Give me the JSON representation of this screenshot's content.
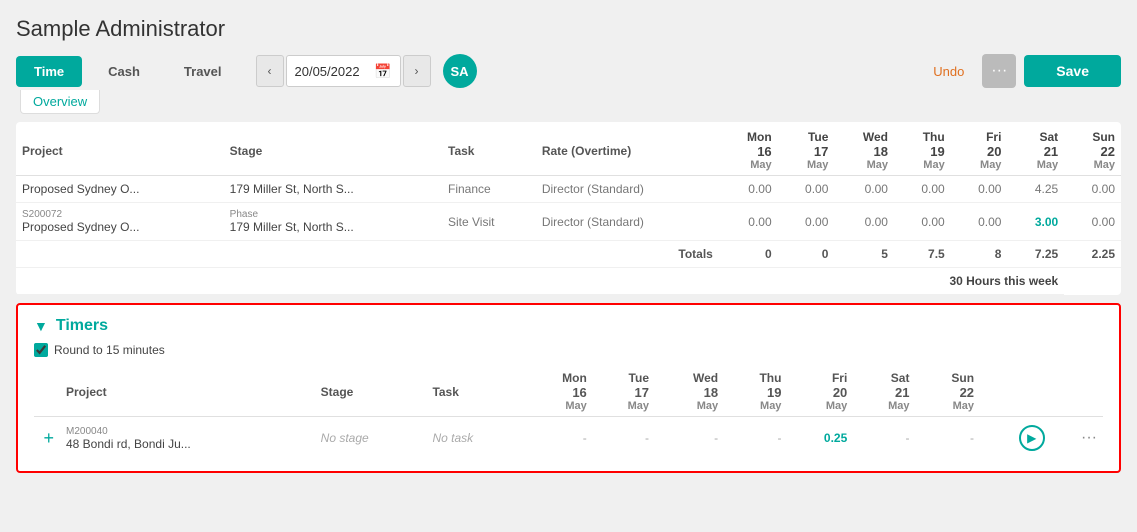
{
  "page": {
    "title": "Sample Administrator"
  },
  "toolbar": {
    "tabs": [
      {
        "id": "time",
        "label": "Time",
        "active": true
      },
      {
        "id": "cash",
        "label": "Cash",
        "active": false
      },
      {
        "id": "travel",
        "label": "Travel",
        "active": false
      }
    ],
    "sub_tabs": [
      {
        "id": "overview",
        "label": "Overview"
      }
    ],
    "date": "20/05/2022",
    "avatar": "SA",
    "undo_label": "Undo",
    "more_label": "...",
    "save_label": "Save"
  },
  "time_table": {
    "columns": {
      "project": "Project",
      "stage": "Stage",
      "task": "Task",
      "rate": "Rate (Overtime)",
      "days": [
        {
          "name": "Mon",
          "num": "16",
          "month": "May"
        },
        {
          "name": "Tue",
          "num": "17",
          "month": "May"
        },
        {
          "name": "Wed",
          "num": "18",
          "month": "May"
        },
        {
          "name": "Thu",
          "num": "19",
          "month": "May"
        },
        {
          "name": "Fri",
          "num": "20",
          "month": "May"
        },
        {
          "name": "Sat",
          "num": "21",
          "month": "May"
        },
        {
          "name": "Sun",
          "num": "22",
          "month": "May"
        }
      ]
    },
    "rows": [
      {
        "proj_code": "",
        "proj_name": "Proposed Sydney O...",
        "stage_phase": "",
        "stage_name": "179 Miller St, North S...",
        "task": "Finance",
        "rate": "Director (Standard)",
        "values": [
          "0.00",
          "0.00",
          "0.00",
          "0.00",
          "0.00",
          "4.25",
          "0.00"
        ],
        "teal_index": -1
      },
      {
        "proj_code": "S200072",
        "proj_name": "Proposed Sydney O...",
        "stage_phase": "Phase",
        "stage_name": "179 Miller St, North S...",
        "task": "Site Visit",
        "rate": "Director (Standard)",
        "values": [
          "0.00",
          "0.00",
          "0.00",
          "0.00",
          "0.00",
          "3.00",
          "0.00"
        ],
        "teal_index": 5
      }
    ],
    "totals": {
      "label": "Totals",
      "values": [
        "0",
        "0",
        "5",
        "7.5",
        "8",
        "7.25",
        "2.25"
      ]
    },
    "hours_this_week": {
      "count": "30",
      "label": "Hours this week"
    }
  },
  "timers_section": {
    "title": "Timers",
    "round_label": "Round to 15 minutes",
    "columns": {
      "project": "Project",
      "stage": "Stage",
      "task": "Task",
      "days": [
        {
          "name": "Mon",
          "num": "16",
          "month": "May"
        },
        {
          "name": "Tue",
          "num": "17",
          "month": "May"
        },
        {
          "name": "Wed",
          "num": "18",
          "month": "May"
        },
        {
          "name": "Thu",
          "num": "19",
          "month": "May"
        },
        {
          "name": "Fri",
          "num": "20",
          "month": "May"
        },
        {
          "name": "Sat",
          "num": "21",
          "month": "May"
        },
        {
          "name": "Sun",
          "num": "22",
          "month": "May"
        }
      ]
    },
    "rows": [
      {
        "proj_code": "M200040",
        "proj_name": "48 Bondi rd, Bondi Ju...",
        "stage": "No stage",
        "task": "No task",
        "values": [
          "-",
          "-",
          "-",
          "-",
          "0.25",
          "-",
          "-"
        ],
        "teal_index": 4,
        "has_play": true
      }
    ]
  }
}
